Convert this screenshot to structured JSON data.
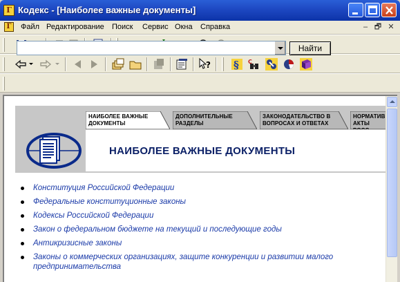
{
  "window": {
    "title": "Кодекс - [Наиболее важные документы]",
    "app_icon_glyph": "Г"
  },
  "menu": {
    "items": [
      "Файл",
      "Редактирование",
      "Поиск",
      "Сервис",
      "Окна",
      "Справка"
    ],
    "mdi_controls": [
      "–",
      "🗗",
      "✕"
    ]
  },
  "search": {
    "value": "",
    "button_label": "Найти"
  },
  "banner": {
    "tabs": [
      {
        "label": "Наиболее важные документы",
        "active": true
      },
      {
        "label": "Дополнительные разделы",
        "active": false
      },
      {
        "label": "Законодательство в вопросах и ответах",
        "active": false
      },
      {
        "label": "Норматив… акты росс…",
        "active": false
      }
    ],
    "heading": "НАИБОЛЕЕ ВАЖНЫЕ ДОКУМЕНТЫ"
  },
  "documents": [
    "Конституция Российской Федерации",
    "Федеральные конституционные законы",
    "Кодексы Российской Федерации",
    "Закон о федеральном бюджете на текущий и последующие годы",
    "Антикризисные законы",
    "Законы о коммерческих организациях, защите конкуренции и развитии малого предпринимательства"
  ],
  "colors": {
    "titlebar": "#1d48c2",
    "link": "#1a3aa8",
    "heading": "#0a1f66",
    "banner_gray": "#c7c7c7"
  }
}
